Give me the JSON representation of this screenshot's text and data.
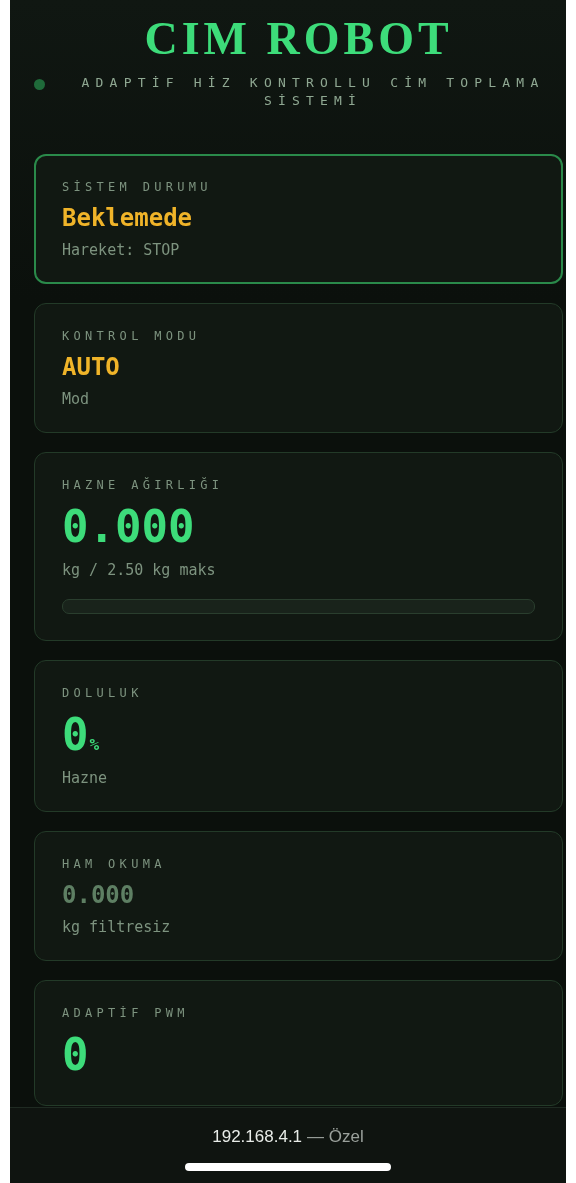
{
  "header": {
    "title": "CIM ROBOT",
    "subtitle": "ADAPTİF HİZ KONTROLLU CİM TOPLAMA SİSTEMİ",
    "status_dot": true
  },
  "cards": [
    {
      "label": "SİSTEM DURUMU",
      "value": "Beklemede",
      "kind": "status",
      "caption": "Hareket: STOP",
      "highlighted": true
    },
    {
      "label": "KONTROL MODU",
      "value": "AUTO",
      "kind": "status",
      "caption": "Mod",
      "highlighted": false
    },
    {
      "label": "HAZNE AĞIRLIĞI",
      "value": "0.000",
      "kind": "metric",
      "caption": "kg / 2.50 kg maks",
      "level": 0,
      "highlighted": false
    },
    {
      "label": "DOLULUK",
      "value": "0",
      "unit": "%",
      "kind": "metric",
      "caption": "Hazne",
      "highlighted": false
    },
    {
      "label": "HAM OKUMA",
      "value": "0.000",
      "kind": "raw",
      "caption": "kg filtresiz",
      "highlighted": false
    },
    {
      "label": "ADAPTİF PWM",
      "value": "0",
      "kind": "metric",
      "highlighted": false
    }
  ],
  "address_bar": {
    "url": "192.168.4.1",
    "note": "— Özel"
  }
}
